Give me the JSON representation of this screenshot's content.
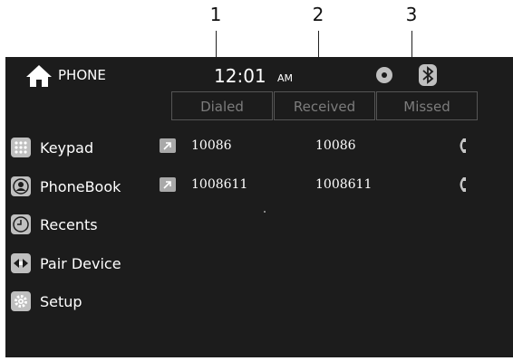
{
  "callouts": [
    "1",
    "2",
    "3"
  ],
  "header": {
    "title": "PHONE",
    "time": "12:01",
    "ampm": "AM"
  },
  "tabs": [
    {
      "label": "Dialed"
    },
    {
      "label": "Received"
    },
    {
      "label": "Missed"
    }
  ],
  "sidebar": {
    "items": [
      {
        "label": "Keypad",
        "icon": "keypad-icon"
      },
      {
        "label": "PhoneBook",
        "icon": "phonebook-icon"
      },
      {
        "label": "Recents",
        "icon": "clock-icon"
      },
      {
        "label": "Pair Device",
        "icon": "pair-device-icon"
      },
      {
        "label": "Setup",
        "icon": "gear-icon"
      }
    ]
  },
  "calls": [
    {
      "number": "10086",
      "name": "10086"
    },
    {
      "number": "1008611",
      "name": "1008611"
    }
  ]
}
